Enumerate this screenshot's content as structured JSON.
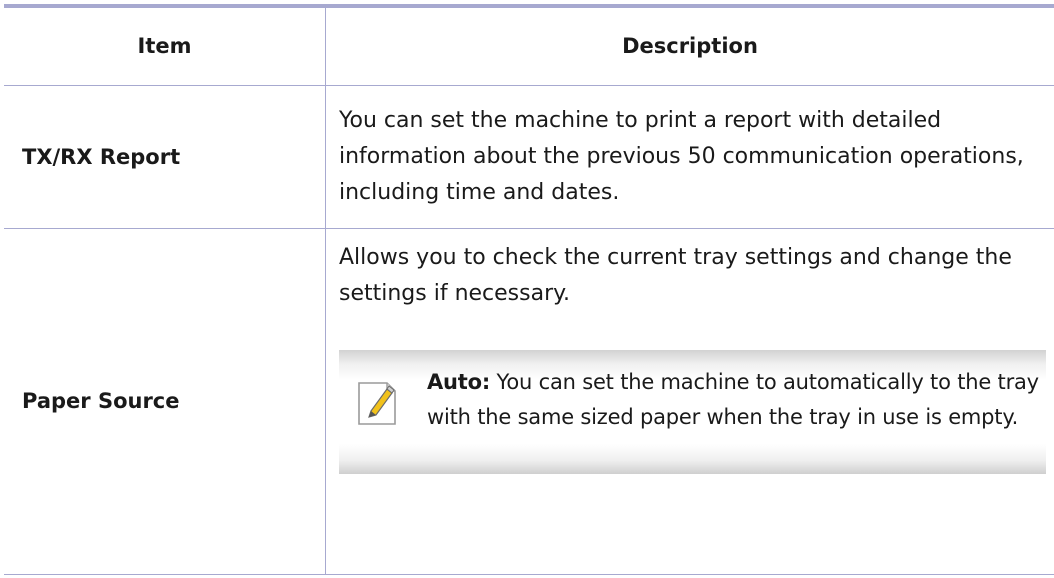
{
  "table": {
    "headers": {
      "item": "Item",
      "description": "Description"
    },
    "rows": [
      {
        "item": "TX/RX Report",
        "description": "You can set the machine to print a report with detailed information about the previous 50 communication operations, including time and dates."
      },
      {
        "item": "Paper Source",
        "description": "Allows you to check the current tray settings and change the settings if necessary.",
        "note": {
          "icon": "note-pencil-icon",
          "label": "Auto:",
          "text": " You can set the machine to automatically to the tray with the same sized paper when the tray in use is empty."
        }
      }
    ]
  },
  "colors": {
    "rule": "#a7a9d0",
    "icon_accent": "#f2c21b"
  }
}
